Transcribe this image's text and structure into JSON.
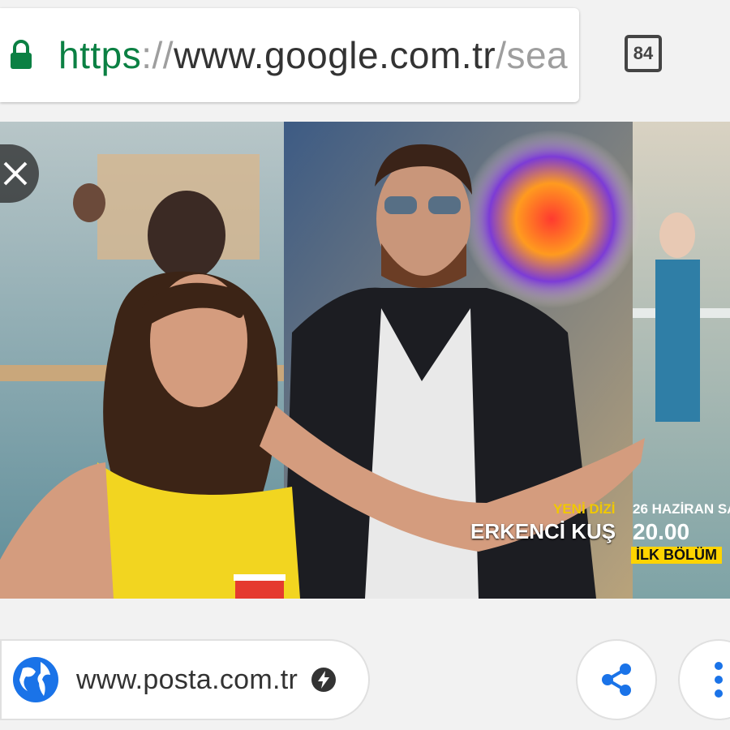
{
  "address_bar": {
    "scheme": "https",
    "separator": "://",
    "host": "www.google.com.tr",
    "path": "/sea",
    "lock_icon": "lock-icon"
  },
  "tabs": {
    "count": "84"
  },
  "image": {
    "description_icon": "close-icon",
    "overlay": {
      "label_new": "YENİ DİZİ",
      "show_title": "ERKENCİ KUŞ",
      "date": "26 HAZİRAN SA",
      "time": "20.00",
      "badge": "İLK BÖLÜM"
    }
  },
  "source": {
    "url": "www.posta.com.tr",
    "globe_icon": "globe-icon",
    "amp_icon": "lightning-icon"
  },
  "actions": {
    "share_icon": "share-icon",
    "more_icon": "more-vert-icon"
  },
  "colors": {
    "secure_green": "#0b8043",
    "link_blue": "#1a73e8",
    "badge_yellow": "#ffd400"
  }
}
